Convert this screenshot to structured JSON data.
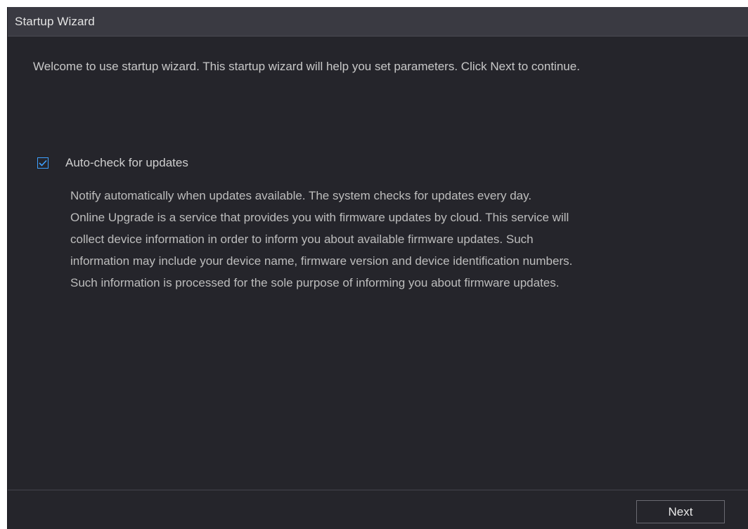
{
  "window": {
    "title": "Startup Wizard"
  },
  "main": {
    "welcome_text": "Welcome to use startup wizard. This startup wizard will help you set parameters. Click Next to continue.",
    "auto_check": {
      "label": "Auto-check for updates",
      "checked": true,
      "check_icon": "checkmark-icon",
      "accent_color": "#3ea0ff"
    },
    "description_lines": [
      "Notify automatically when updates available. The system checks for updates every day.",
      "Online Upgrade is a service that provides you with firmware updates by cloud. This service will",
      "collect device information in order to inform you about available firmware updates. Such",
      "information may include your device name, firmware version and device identification numbers.",
      "Such information is processed for the sole purpose of informing you about firmware updates."
    ]
  },
  "footer": {
    "next_label": "Next"
  }
}
